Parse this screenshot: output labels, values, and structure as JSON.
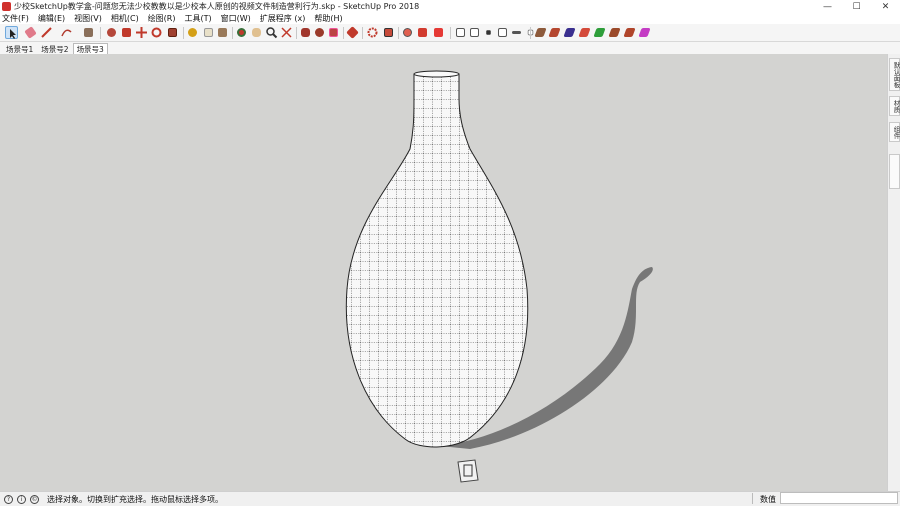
{
  "window": {
    "title": "少校SketchUp教学盒-问题您无法少校教教以是少校本人原创的视频文件制造营利行为.skp - SketchUp Pro 2018",
    "minimize": "—",
    "maximize": "☐",
    "close": "✕"
  },
  "menu": {
    "items": [
      "文件(F)",
      "编辑(E)",
      "视图(V)",
      "相机(C)",
      "绘图(R)",
      "工具(T)",
      "窗口(W)",
      "扩展程序 (x)",
      "帮助(H)"
    ]
  },
  "scenes": {
    "tabs": [
      "场景号1",
      "场景号2",
      "场景号3"
    ],
    "active_index": 2
  },
  "tray": {
    "tabs": [
      "默认面板",
      "材质",
      "组件"
    ]
  },
  "status": {
    "message": "选择对象。切换到扩充选择。拖动鼠标选择多项。",
    "measurements_label": "数值",
    "icons": [
      "geo-location-icon",
      "info-icon",
      "user-icon"
    ]
  },
  "colors": {
    "viewport_bg": "#d3d3d1",
    "shadow": "#777777",
    "vase_fill": "#f8f8f8",
    "selection_blue": "#cfe3f7"
  }
}
